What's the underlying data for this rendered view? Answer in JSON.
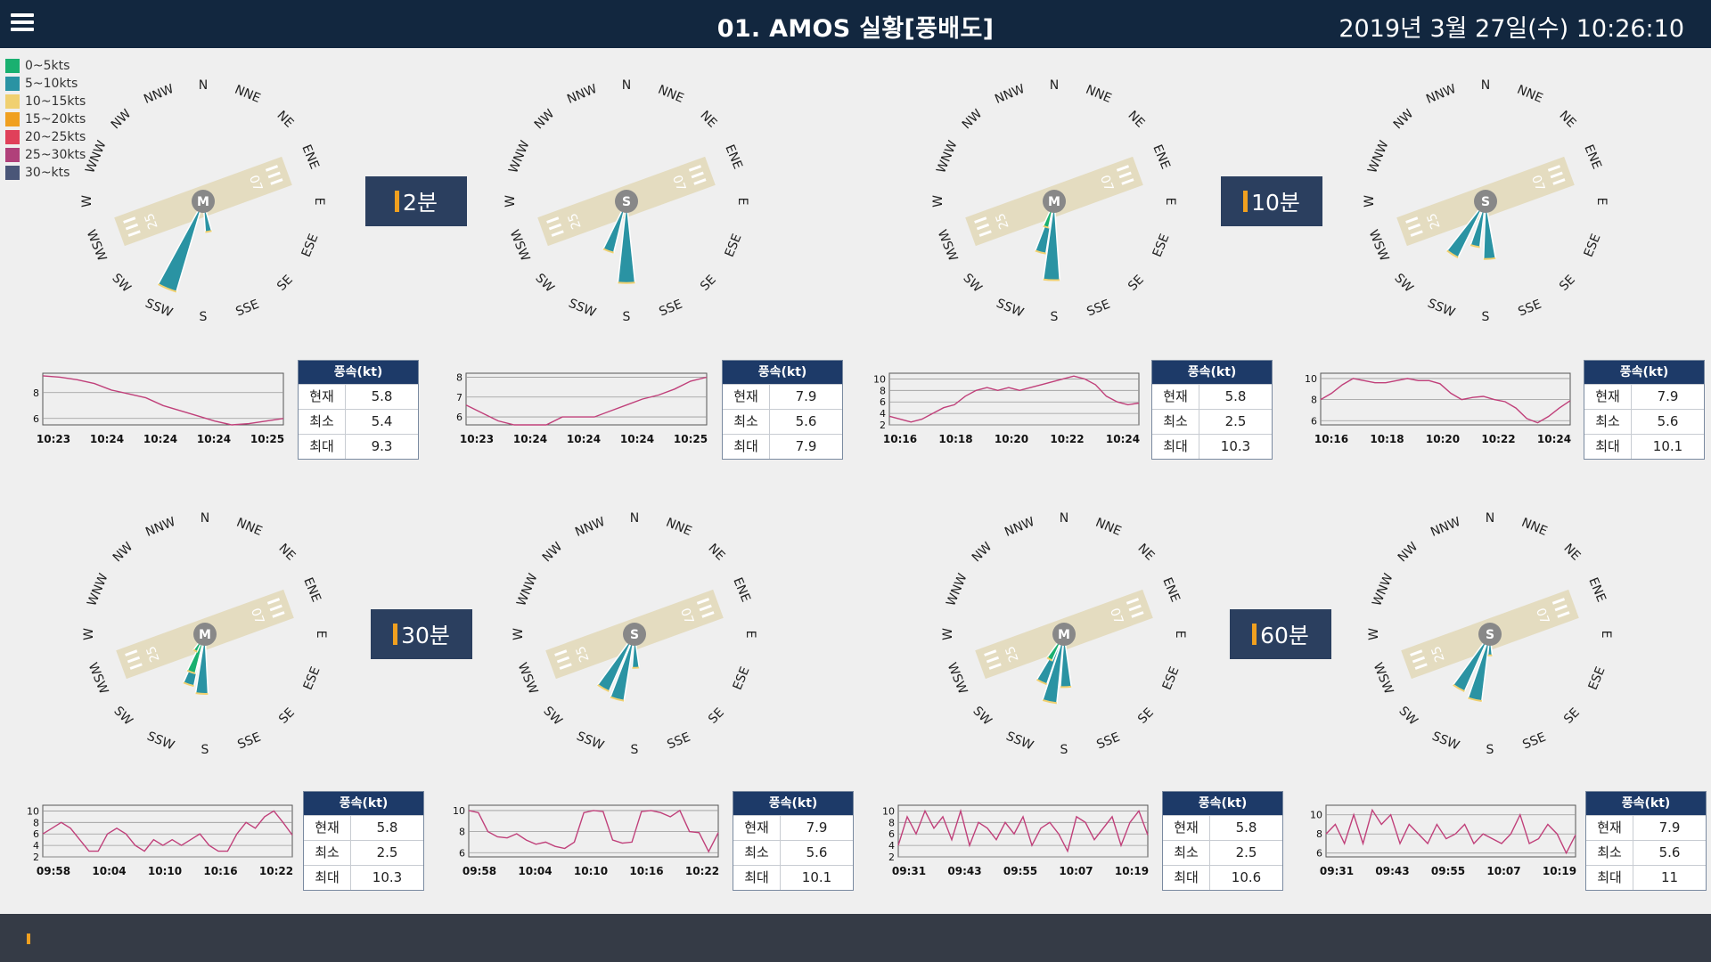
{
  "header": {
    "title": "01. AMOS 실황[풍배도]",
    "datetime": "2019년 3월 27일(수) 10:26:10"
  },
  "legend": [
    {
      "label": "0~5kts",
      "color": "#1ab070"
    },
    {
      "label": "5~10kts",
      "color": "#2a93a3"
    },
    {
      "label": "10~15kts",
      "color": "#f0d070"
    },
    {
      "label": "15~20kts",
      "color": "#f0a020"
    },
    {
      "label": "20~25kts",
      "color": "#e0405a"
    },
    {
      "label": "25~30kts",
      "color": "#b0407a"
    },
    {
      "label": "30~kts",
      "color": "#4a5678"
    }
  ],
  "compass_labels": [
    "N",
    "NNE",
    "NE",
    "ENE",
    "E",
    "ESE",
    "SE",
    "SSE",
    "S",
    "SSW",
    "SW",
    "WSW",
    "W",
    "WNW",
    "NW",
    "NNW"
  ],
  "runway": {
    "left_label": "25",
    "right_label": "07"
  },
  "stat_labels": {
    "header": "풍속(kt)",
    "current": "현재",
    "min": "최소",
    "max": "최대"
  },
  "groups": [
    {
      "label": "2분",
      "label_pos": "g1"
    },
    {
      "label": "10분",
      "label_pos": "g2"
    },
    {
      "label": "30분",
      "label_pos": "g3"
    },
    {
      "label": "60분",
      "label_pos": "g4"
    }
  ],
  "panels": [
    {
      "center": "M",
      "petals": [
        {
          "dir": 202.5,
          "len": 0.98,
          "color": "#2a93a3"
        },
        {
          "dir": 170,
          "len": 0.32,
          "color": "#2a93a3"
        }
      ],
      "stats": {
        "current": "5.8",
        "min": "5.4",
        "max": "9.3"
      },
      "chart_data": {
        "type": "line",
        "x": [
          "10:23",
          "10:24",
          "10:24",
          "10:24",
          "10:25"
        ],
        "yticks": [
          6,
          8
        ],
        "ylim": [
          5.5,
          9.5
        ],
        "values": [
          9.3,
          9.2,
          9.0,
          8.7,
          8.2,
          7.9,
          7.6,
          7.0,
          6.6,
          6.2,
          5.8,
          5.5,
          5.6,
          5.8,
          6.0
        ],
        "color": "#c0407a"
      }
    },
    {
      "center": "S",
      "petals": [
        {
          "dir": 200,
          "len": 0.55,
          "color": "#2a93a3"
        },
        {
          "dir": 180,
          "len": 0.85,
          "color": "#2a93a3"
        }
      ],
      "stats": {
        "current": "7.9",
        "min": "5.6",
        "max": "7.9"
      },
      "chart_data": {
        "type": "line",
        "x": [
          "10:23",
          "10:24",
          "10:24",
          "10:24",
          "10:25"
        ],
        "yticks": [
          6,
          7,
          8
        ],
        "ylim": [
          5.6,
          8.2
        ],
        "values": [
          6.6,
          6.2,
          5.8,
          5.6,
          5.6,
          5.6,
          6.0,
          6.0,
          6.0,
          6.3,
          6.6,
          6.9,
          7.1,
          7.4,
          7.8,
          8.0
        ],
        "color": "#c0407a",
        "color2": "#8a40c0"
      }
    },
    {
      "center": "M",
      "petals": [
        {
          "dir": 195,
          "len": 0.55,
          "color": "#2a93a3"
        },
        {
          "dir": 182,
          "len": 0.82,
          "color": "#2a93a3"
        },
        {
          "dir": 198,
          "len": 0.28,
          "color": "#1ab070"
        }
      ],
      "stats": {
        "current": "5.8",
        "min": "2.5",
        "max": "10.3"
      },
      "chart_data": {
        "type": "line",
        "x": [
          "10:16",
          "10:18",
          "10:20",
          "10:22",
          "10:24"
        ],
        "yticks": [
          2,
          4,
          6,
          8,
          10
        ],
        "ylim": [
          2,
          11
        ],
        "values": [
          3.5,
          3,
          2.5,
          3,
          4,
          5,
          5.5,
          7,
          8,
          8.5,
          8,
          8.5,
          8,
          8.5,
          9,
          9.5,
          10,
          10.5,
          10,
          9,
          7,
          6,
          5.5,
          5.8
        ],
        "color": "#c0407a"
      }
    },
    {
      "center": "S",
      "petals": [
        {
          "dir": 212,
          "len": 0.65,
          "color": "#2a93a3"
        },
        {
          "dir": 193,
          "len": 0.48,
          "color": "#2a93a3"
        },
        {
          "dir": 176,
          "len": 0.6,
          "color": "#2a93a3"
        }
      ],
      "stats": {
        "current": "7.9",
        "min": "5.6",
        "max": "10.1"
      },
      "chart_data": {
        "type": "line",
        "x": [
          "10:16",
          "10:18",
          "10:20",
          "10:22",
          "10:24"
        ],
        "yticks": [
          6,
          8,
          10
        ],
        "ylim": [
          5.6,
          10.5
        ],
        "values": [
          8,
          8.6,
          9.4,
          10,
          9.8,
          9.6,
          9.6,
          9.8,
          10,
          9.8,
          9.8,
          9.5,
          8.6,
          8,
          8.2,
          8.3,
          8,
          7.8,
          7.2,
          6.2,
          5.8,
          6.4,
          7.2,
          7.9
        ],
        "color": "#c0407a"
      }
    },
    {
      "center": "M",
      "petals": [
        {
          "dir": 198,
          "len": 0.55,
          "color": "#2a93a3"
        },
        {
          "dir": 183,
          "len": 0.62,
          "color": "#2a93a3"
        },
        {
          "dir": 200,
          "len": 0.42,
          "color": "#1ab070"
        },
        {
          "dir": 210,
          "len": 0.2,
          "color": "#1ab070"
        }
      ],
      "stats": {
        "current": "5.8",
        "min": "2.5",
        "max": "10.3"
      },
      "chart_data": {
        "type": "line",
        "x": [
          "09:58",
          "10:04",
          "10:10",
          "10:16",
          "10:22"
        ],
        "yticks": [
          2,
          4,
          6,
          8,
          10
        ],
        "ylim": [
          2,
          11
        ],
        "values": [
          6,
          7,
          8,
          7,
          5,
          3,
          3,
          6,
          7,
          6,
          4,
          3,
          5,
          4,
          5,
          4,
          5,
          6,
          4,
          3,
          3,
          6,
          8,
          7,
          9,
          10,
          8,
          5.8
        ],
        "color": "#c0407a"
      }
    },
    {
      "center": "S",
      "petals": [
        {
          "dir": 210,
          "len": 0.65,
          "color": "#2a93a3"
        },
        {
          "dir": 195,
          "len": 0.7,
          "color": "#2a93a3"
        },
        {
          "dir": 178,
          "len": 0.35,
          "color": "#2a93a3"
        }
      ],
      "stats": {
        "current": "7.9",
        "min": "5.6",
        "max": "10.1"
      },
      "chart_data": {
        "type": "line",
        "x": [
          "09:58",
          "10:04",
          "10:10",
          "10:16",
          "10:22"
        ],
        "yticks": [
          6,
          8,
          10
        ],
        "ylim": [
          5.6,
          10.5
        ],
        "values": [
          10,
          9.8,
          8,
          7.5,
          7.4,
          7.8,
          7.2,
          6.8,
          7,
          6.6,
          6.4,
          7,
          9.8,
          10,
          9.9,
          7.2,
          6.9,
          7,
          9.9,
          10,
          9.8,
          9.4,
          10,
          8,
          7.9,
          6.1,
          7.9
        ],
        "color": "#c0407a"
      }
    },
    {
      "center": "M",
      "petals": [
        {
          "dir": 205,
          "len": 0.55,
          "color": "#2a93a3"
        },
        {
          "dir": 192,
          "len": 0.72,
          "color": "#2a93a3"
        },
        {
          "dir": 178,
          "len": 0.55,
          "color": "#2a93a3"
        },
        {
          "dir": 210,
          "len": 0.3,
          "color": "#1ab070"
        }
      ],
      "stats": {
        "current": "5.8",
        "min": "2.5",
        "max": "10.6"
      },
      "chart_data": {
        "type": "line",
        "x": [
          "09:31",
          "09:43",
          "09:55",
          "10:07",
          "10:19"
        ],
        "yticks": [
          2,
          4,
          6,
          8,
          10
        ],
        "ylim": [
          2,
          11
        ],
        "values": [
          4,
          9,
          6,
          10,
          7,
          9,
          5,
          10,
          4,
          8,
          7,
          5,
          8,
          6,
          9,
          4,
          7,
          8,
          6,
          3,
          9,
          8,
          5,
          7,
          9,
          4,
          8,
          10,
          5.8
        ],
        "color": "#c0407a"
      }
    },
    {
      "center": "S",
      "petals": [
        {
          "dir": 210,
          "len": 0.65,
          "color": "#2a93a3"
        },
        {
          "dir": 193,
          "len": 0.7,
          "color": "#2a93a3"
        },
        {
          "dir": 180,
          "len": 0.22,
          "color": "#2a93a3"
        }
      ],
      "stats": {
        "current": "7.9",
        "min": "5.6",
        "max": "11"
      },
      "chart_data": {
        "type": "line",
        "x": [
          "09:31",
          "09:43",
          "09:55",
          "10:07",
          "10:19"
        ],
        "yticks": [
          6,
          8,
          10
        ],
        "ylim": [
          5.6,
          11
        ],
        "values": [
          8,
          9,
          7,
          10,
          7,
          10.5,
          9,
          10,
          7,
          9,
          8,
          7,
          9,
          7.5,
          8,
          9,
          7,
          8,
          7.5,
          7,
          8,
          10,
          7,
          7.5,
          9,
          8,
          6,
          7.9
        ],
        "color": "#c0407a"
      }
    }
  ]
}
